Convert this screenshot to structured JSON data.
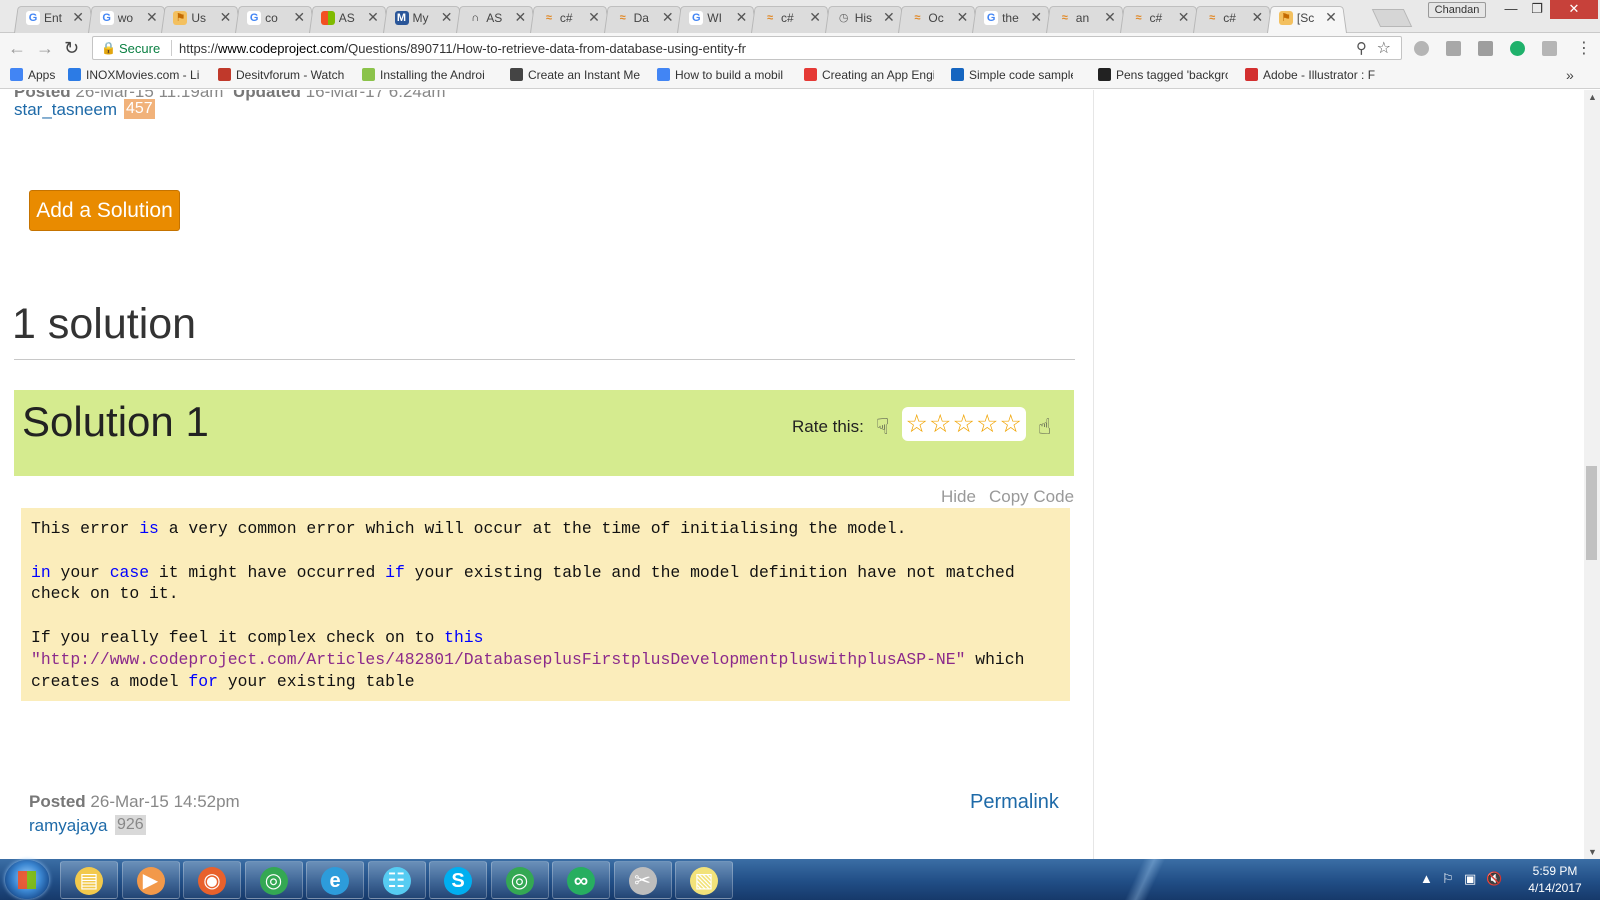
{
  "browser": {
    "tabs": [
      {
        "label": "Ent",
        "icon": "google-icon",
        "active": false
      },
      {
        "label": "wo",
        "icon": "google-icon",
        "active": false
      },
      {
        "label": "Us",
        "icon": "codeproject-icon",
        "active": false
      },
      {
        "label": "co",
        "icon": "google-icon",
        "active": false
      },
      {
        "label": "AS",
        "icon": "microsoft-icon",
        "active": false
      },
      {
        "label": "My",
        "icon": "blue-site-icon",
        "active": false
      },
      {
        "label": "AS",
        "icon": "dark-site-icon",
        "active": false
      },
      {
        "label": "c#",
        "icon": "stackoverflow-icon",
        "active": false
      },
      {
        "label": "Da",
        "icon": "site-icon",
        "active": false
      },
      {
        "label": "WI",
        "icon": "google-icon",
        "active": false
      },
      {
        "label": "c#",
        "icon": "stackoverflow-icon",
        "active": false
      },
      {
        "label": "His",
        "icon": "history-icon",
        "active": false
      },
      {
        "label": "Oc",
        "icon": "stackoverflow-icon",
        "active": false
      },
      {
        "label": "the",
        "icon": "google-icon",
        "active": false
      },
      {
        "label": "an",
        "icon": "stackoverflow-icon",
        "active": false
      },
      {
        "label": "c#",
        "icon": "stackoverflow-icon",
        "active": false
      },
      {
        "label": "c#",
        "icon": "stackoverflow-icon",
        "active": false
      },
      {
        "label": "[Sc",
        "icon": "codeproject-icon",
        "active": true
      }
    ],
    "profile_name": "Chandan",
    "security_label": "Secure",
    "url_scheme": "https://",
    "url_host": "www.codeproject.com",
    "url_path": "/Questions/890711/How-to-retrieve-data-from-database-using-entity-fr",
    "bookmarks": [
      {
        "label": "Apps",
        "icon_color": "#4285f4"
      },
      {
        "label": "INOXMovies.com - Li",
        "icon_color": "#2c7be5"
      },
      {
        "label": "Desitvforum - Watch",
        "icon_color": "#c0392b"
      },
      {
        "label": "Installing the Androi",
        "icon_color": "#8bc34a"
      },
      {
        "label": "Create an Instant Me",
        "icon_color": "#444444"
      },
      {
        "label": "How to build a mobil",
        "icon_color": "#4285f4"
      },
      {
        "label": "Creating an App Engi",
        "icon_color": "#e53935"
      },
      {
        "label": "Simple code sample f",
        "icon_color": "#1565c0"
      },
      {
        "label": "Pens tagged 'backgro",
        "icon_color": "#222222"
      },
      {
        "label": "Adobe - Illustrator : F",
        "icon_color": "#d32f2f"
      }
    ]
  },
  "page": {
    "previous_post": {
      "posted_label": "Posted",
      "posted_date": "26-Mar-15 11:19am",
      "updated_label": "Updated",
      "updated_date": "16-Mar-17 6:24am",
      "author": "star_tasneem",
      "reputation": "457"
    },
    "add_solution_label": "Add a Solution",
    "solutions_count_label": "1 solution",
    "solution": {
      "title": "Solution 1",
      "rate_label": "Rate this:",
      "rating_stars": 0,
      "hide_label": "Hide",
      "copy_code_label": "Copy Code",
      "code_lines": [
        [
          {
            "t": "This error "
          },
          {
            "t": "is",
            "k": "kw"
          },
          {
            "t": " a very common error which will occur at the time of initialising the model."
          }
        ],
        [],
        [
          {
            "t": "in",
            "k": "kw"
          },
          {
            "t": " your "
          },
          {
            "t": "case",
            "k": "kw"
          },
          {
            "t": " it might have occurred "
          },
          {
            "t": "if",
            "k": "kw"
          },
          {
            "t": " your existing table and the model definition have not matched"
          }
        ],
        [
          {
            "t": "check on to it."
          }
        ],
        [],
        [
          {
            "t": "If you really feel it complex check on to "
          },
          {
            "t": "this",
            "k": "kw"
          }
        ],
        [
          {
            "t": "\"http://www.codeproject.com/Articles/482801/DatabaseplusFirstplusDevelopmentpluswithplusASP-NE\"",
            "k": "str"
          },
          {
            "t": " which"
          }
        ],
        [
          {
            "t": "creates a model "
          },
          {
            "t": "for",
            "k": "kw"
          },
          {
            "t": " your existing table"
          }
        ]
      ],
      "posted_label": "Posted",
      "posted_date": "26-Mar-15 14:52pm",
      "author": "ramyajaya",
      "reputation": "926",
      "permalink_label": "Permalink"
    }
  },
  "taskbar": {
    "apps": [
      {
        "icon": "file-explorer-icon",
        "color": "#f2c94c"
      },
      {
        "icon": "media-player-icon",
        "color": "#f2994a"
      },
      {
        "icon": "firefox-icon",
        "color": "#e8612c"
      },
      {
        "icon": "chrome-icon",
        "color": "#34a853"
      },
      {
        "icon": "internet-explorer-icon",
        "color": "#2d9cdb"
      },
      {
        "icon": "network-icon",
        "color": "#56ccf2"
      },
      {
        "icon": "skype-icon",
        "color": "#00aff0"
      },
      {
        "icon": "chrome-icon",
        "color": "#34a853"
      },
      {
        "icon": "visual-studio-icon",
        "color": "#27ae60"
      },
      {
        "icon": "snipping-tool-icon",
        "color": "#bdbdbd"
      },
      {
        "icon": "sticky-notes-icon",
        "color": "#f2e27a"
      }
    ],
    "clock_time": "5:59 PM",
    "clock_date": "4/14/2017"
  }
}
